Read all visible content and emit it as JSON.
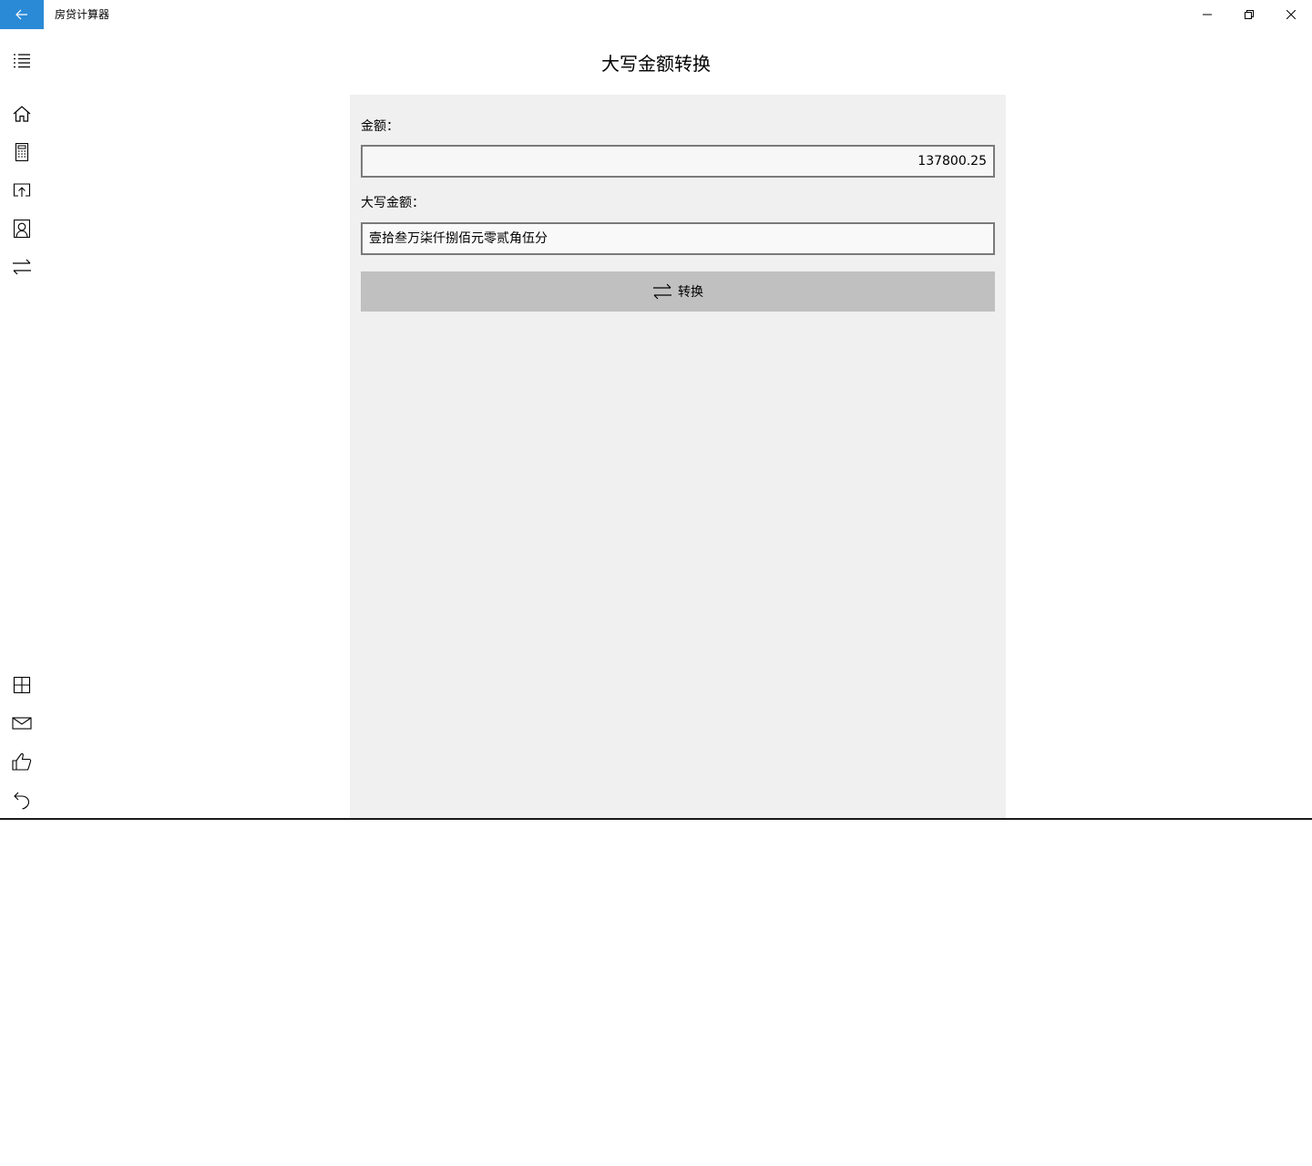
{
  "window": {
    "title": "房贷计算器",
    "accent_color": "#2b8ad6"
  },
  "titlebar": {
    "back_icon": "arrow-left-icon",
    "minimize_icon": "minimize-icon",
    "maximize_icon": "restore-icon",
    "close_icon": "close-icon"
  },
  "nav": {
    "top_items": [
      {
        "icon": "list-icon"
      },
      {
        "icon": "home-icon"
      },
      {
        "icon": "calculator-icon"
      },
      {
        "icon": "upload-icon"
      },
      {
        "icon": "contact-icon"
      },
      {
        "icon": "swap-icon"
      }
    ],
    "bottom_items": [
      {
        "icon": "grid-icon"
      },
      {
        "icon": "mail-icon"
      },
      {
        "icon": "thumbs-up-icon"
      },
      {
        "icon": "undo-icon"
      }
    ]
  },
  "main": {
    "page_title": "大写金额转换",
    "amount_label": "金额：",
    "amount_value": "137800.25",
    "upper_label": "大写金额：",
    "upper_value": "壹拾叁万柒仟捌佰元零贰角伍分",
    "convert_label": "转换",
    "convert_icon": "swap-icon",
    "panel_color": "#f0f0f0",
    "button_color": "#c0c0c0"
  }
}
